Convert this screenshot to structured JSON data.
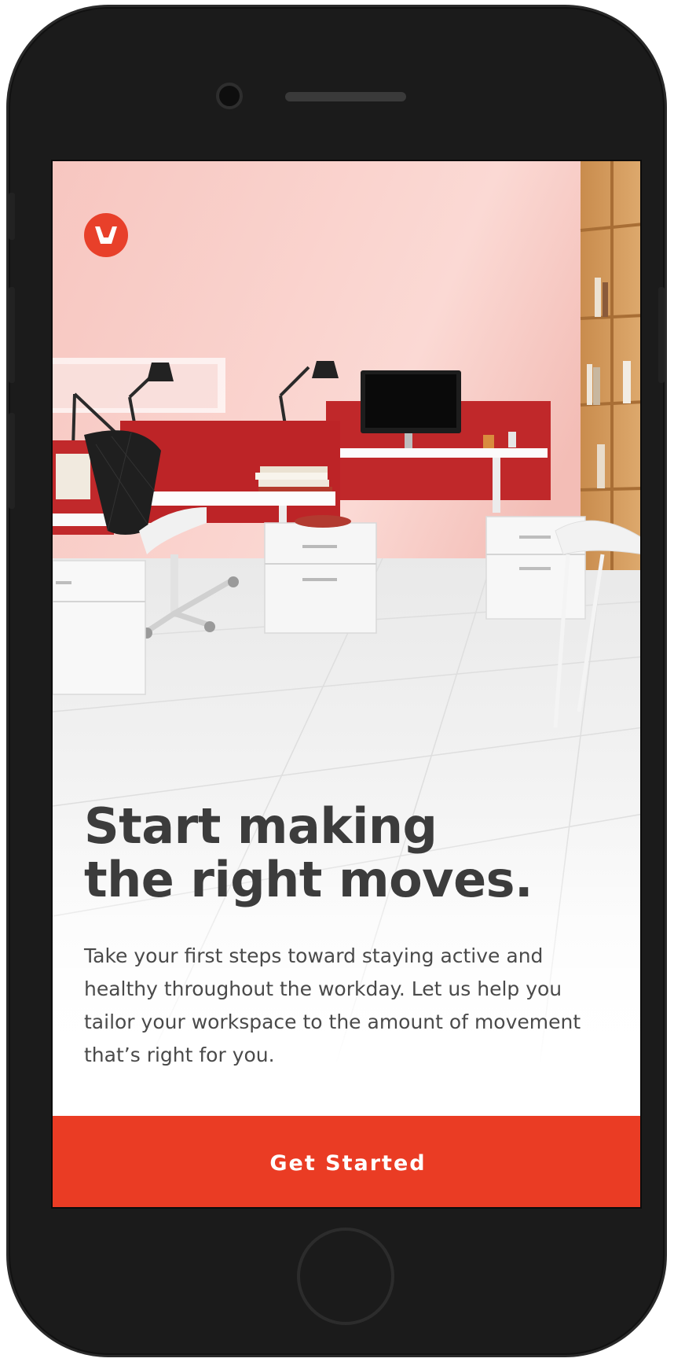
{
  "device": {
    "type": "phone"
  },
  "hero": {
    "image_description_icon": "office-workspace-image",
    "logo_icon": "herman-miller-logo-icon"
  },
  "onboarding": {
    "headline_line1": "Start making",
    "headline_line2": "the right moves.",
    "body": "Take your first steps toward staying active and healthy throughout the workday. Let us help you tailor your workspace to the amount of movement that’s right for you.",
    "cta_label": "Get Started"
  },
  "colors": {
    "accent": "#ea3c24",
    "logo": "#e8402a",
    "headline": "#3c3c3c",
    "body": "#4a4a4a",
    "wall": "#f5c3bd",
    "panel_red": "#c0282a"
  }
}
